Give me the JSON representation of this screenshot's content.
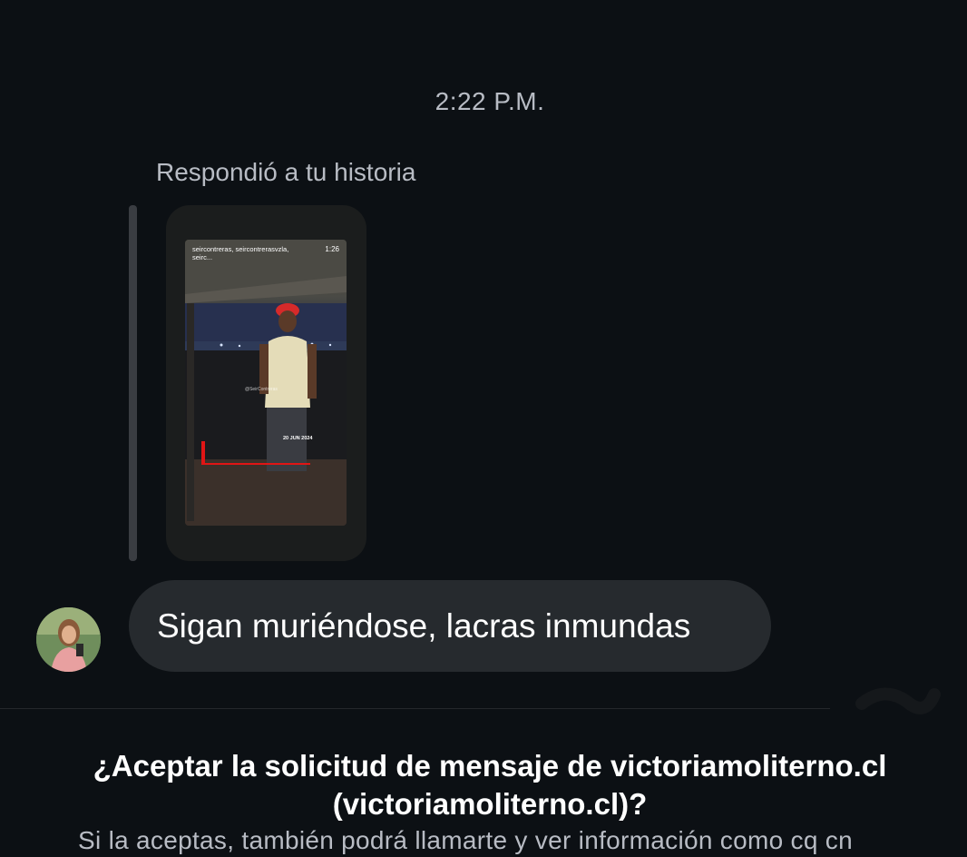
{
  "chat": {
    "timestamp": "2:22 P.M.",
    "reply_label": "Respondió a tu historia",
    "story": {
      "username": "seircontreras, seircontrerasvzla, seirc...",
      "duration": "1:26",
      "date_overlay": "20 JUN 2024",
      "watermark": "@SeirContreras"
    },
    "message": {
      "text": "Sigan muriéndose, lacras inmundas"
    }
  },
  "request": {
    "title": "¿Aceptar la solicitud de mensaje de victoriamoliterno.cl (victoriamoliterno.cl)?",
    "subtitle": "Si la aceptas, también podrá llamarte y ver información como cq cn"
  },
  "colors": {
    "background": "#0c1014",
    "bubble": "#262a2e",
    "secondary_text": "#b8bcc4"
  }
}
